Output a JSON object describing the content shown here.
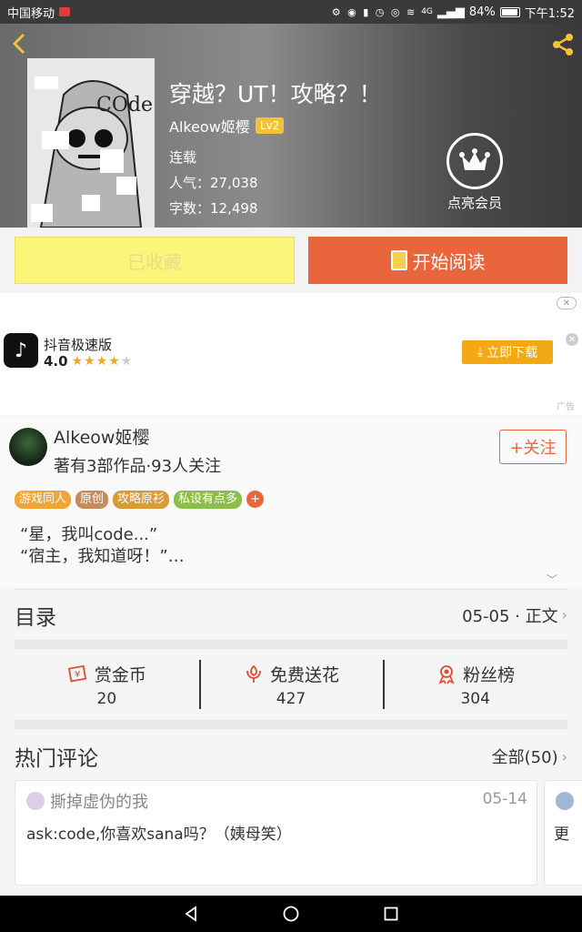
{
  "status_bar": {
    "carrier": "中国移动",
    "icons": "⚙ ◉ ▮ ◷ ◎ ≋",
    "network": "4G",
    "battery": "84%",
    "battery_level": 0.84,
    "time": "下午1:52"
  },
  "book": {
    "title": "穿越？UT！攻略？！",
    "author": "Alkeow姬樱",
    "level": "Lv2",
    "status": "连载",
    "popularity": "人气：27,038",
    "word_count": "字数：12,498",
    "vip_label": "点亮会员",
    "cover_text": "COde"
  },
  "actions": {
    "collected": "已收藏",
    "read": "开始阅读"
  },
  "ad": {
    "app_name": "抖音极速版",
    "rating": "4.0",
    "rating_value": 4,
    "rating_max": 5,
    "download": "立即下载",
    "tag": "广告"
  },
  "author_section": {
    "name": "Alkeow姬樱",
    "stats": "著有3部作品·93人关注",
    "follow": "+关注",
    "tags": [
      {
        "label": "游戏同人",
        "color": "#f0a43a"
      },
      {
        "label": "原创",
        "color": "#c98a5a"
      },
      {
        "label": "攻略原衫",
        "color": "#d99a3a"
      },
      {
        "label": "私设有点多",
        "color": "#8cbf4a"
      }
    ],
    "tag_more": "+",
    "excerpt_line1": "“星，我叫code...”",
    "excerpt_line2": "“宿主，我知道呀！”…"
  },
  "catalog": {
    "title": "目录",
    "latest": "05-05 · 正文"
  },
  "stats": {
    "coins_label": "赏金币",
    "coins_value": "20",
    "flowers_label": "免费送花",
    "flowers_value": "427",
    "fans_label": "粉丝榜",
    "fans_value": "304"
  },
  "comments": {
    "title": "热门评论",
    "all": "全部(50)",
    "items": [
      {
        "user": "撕掉虚伪的我",
        "date": "05-14",
        "text": "ask:code,你喜欢sana吗？（姨母笑）"
      },
      {
        "text": "更"
      }
    ]
  },
  "colors": {
    "accent": "#e9653b",
    "collected_bg": "#fbf57a",
    "download_bg": "#f3a916"
  }
}
